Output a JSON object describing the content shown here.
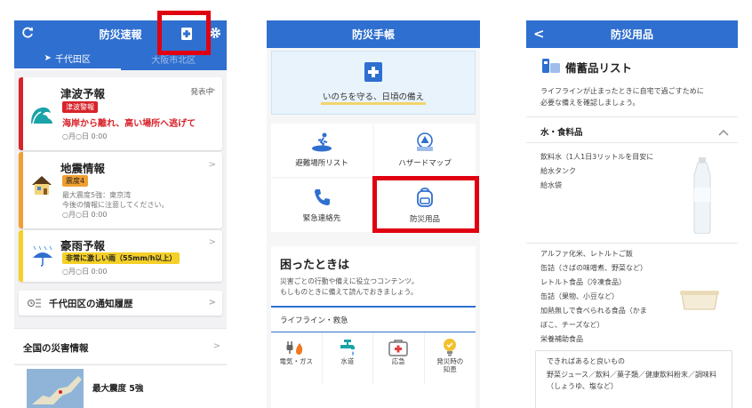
{
  "screen1": {
    "header": {
      "title": "防災速報"
    },
    "tabs": {
      "active": "千代田区",
      "inactive": "大阪市北区"
    },
    "tsunami": {
      "title": "津波予報",
      "status": "発表中",
      "tag": "津波警報",
      "alert": "海岸から離れ、高い場所へ逃げて",
      "date": "○月○日 0:00"
    },
    "quake": {
      "title": "地震情報",
      "tag": "震度4",
      "line1": "最大震度5強：東京湾",
      "line2": "今後の情報に注意してください。",
      "date": "○月○日 0:00"
    },
    "rain": {
      "title": "豪雨予報",
      "tag": "非常に激しい雨（55mm/h以上）",
      "date": "○月○日 0:00"
    },
    "history": {
      "label": "千代田区の通知履歴"
    },
    "national": {
      "label": "全国の災害情報",
      "item": "最大震度 5強"
    }
  },
  "screen2": {
    "header": {
      "title": "防災手帳"
    },
    "banner": {
      "text": "いのちを守る、日頃の備え"
    },
    "tiles": [
      "避難場所リスト",
      "ハザードマップ",
      "緊急連絡先",
      "防災用品"
    ],
    "panel": {
      "title": "困ったときは",
      "desc1": "災害ごとの行動や備えに役立つコンテンツ。",
      "desc2": "もしものときに備えて読んでおきましょう。",
      "section": "ライフライン・救急",
      "icons": [
        "電気・ガス",
        "水道",
        "応急",
        "発災時の\n知恵"
      ]
    }
  },
  "screen3": {
    "header": {
      "title": "防災用品"
    },
    "list_title": "備蓄品リスト",
    "intro1": "ライフラインが止まったときに自宅で過ごすために",
    "intro2": "必要な備えを確認しましょう。",
    "section": "水・食料品",
    "water_items": [
      "飲料水（1人1日3リットルを目安に",
      "給水タンク",
      "給水袋"
    ],
    "food_items": [
      "アルファ化米、レトルトご飯",
      "缶詰（さばの味噌煮、野菜など）",
      "レトルト食品（冷凍食品）",
      "缶詰（果物、小豆など）",
      "加熱無しで食べられる食品（かま",
      "ぼこ、チーズなど）",
      "栄養補助食品"
    ],
    "extra_title": "できればあると良いもの",
    "extra_line1": "野菜ジュース／飲料／菓子類／健康飲料粉末／調味料",
    "extra_line2": "（しょうゆ、塩など）"
  },
  "colors": {
    "header_blue": "#2f6fcf",
    "tsunami_red": "#d8232a",
    "quake_orange": "#f0a030",
    "rain_yellow": "#f5d028",
    "highlight_red": "#e00012"
  }
}
